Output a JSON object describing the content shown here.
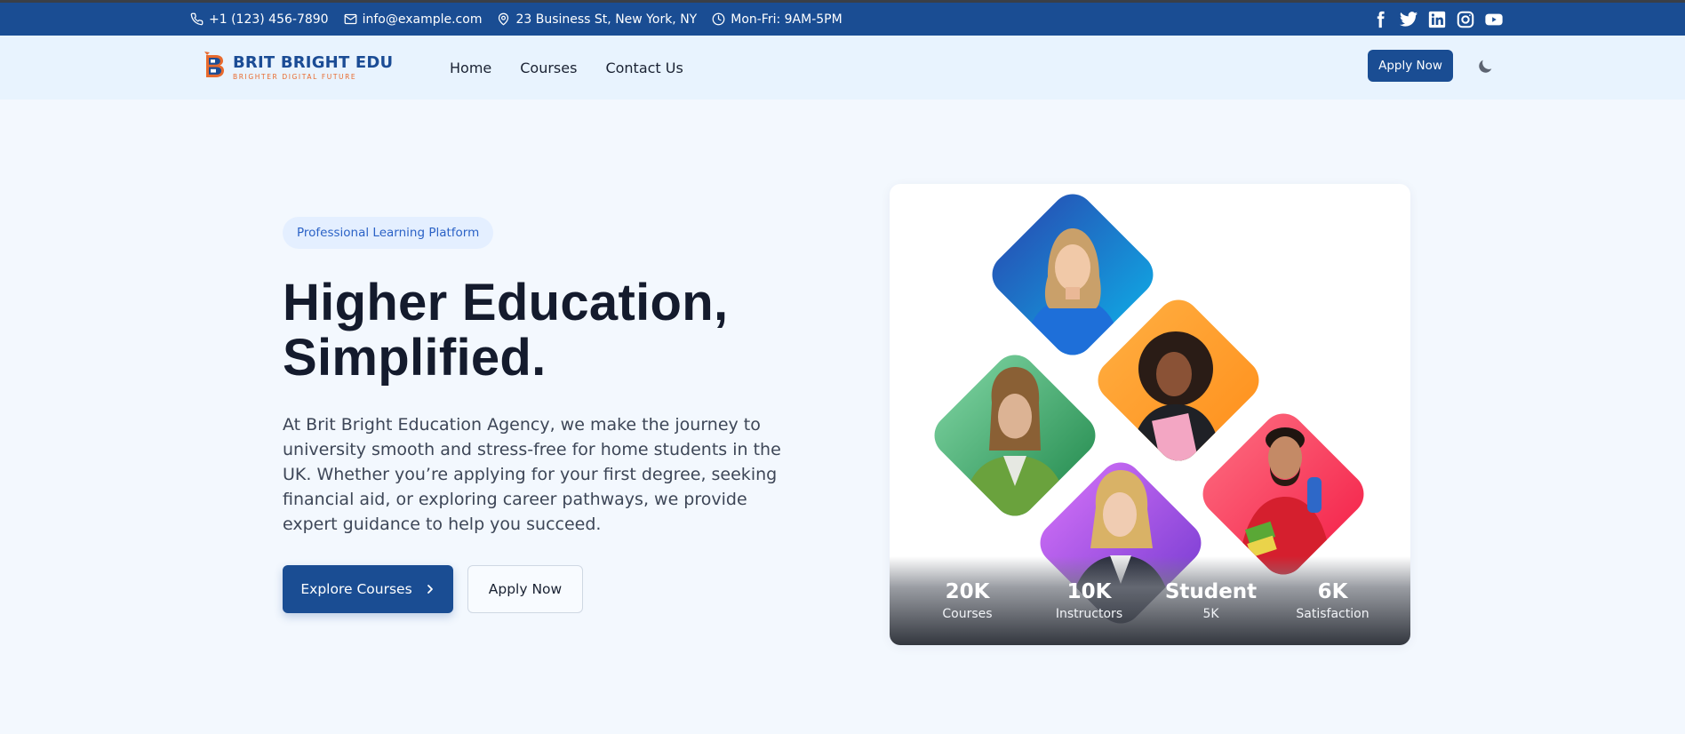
{
  "topbar": {
    "phone": "+1 (123) 456-7890",
    "email": "info@example.com",
    "address": "23 Business St, New York, NY",
    "hours": "Mon-Fri: 9AM-5PM",
    "social": [
      "facebook-icon",
      "twitter-icon",
      "linkedin-icon",
      "instagram-icon",
      "youtube-icon"
    ]
  },
  "nav": {
    "logo_name": "BRIT BRIGHT EDU",
    "logo_tagline": "BRIGHTER DIGITAL FUTURE",
    "items": [
      "Home",
      "Courses",
      "Contact Us"
    ],
    "apply_label": "Apply Now",
    "theme_toggle_icon": "moon-icon"
  },
  "hero": {
    "badge": "Professional Learning Platform",
    "title_line1": "Higher Education,",
    "title_line2": "Simplified.",
    "description": "At Brit Bright Education Agency, we make the journey to university smooth and stress-free for home students in the UK. Whether you’re applying for your first degree, seeking financial aid, or exploring career pathways, we provide expert guidance to help you succeed.",
    "primary_cta": "Explore Courses",
    "secondary_cta": "Apply Now"
  },
  "stats": [
    {
      "value": "20K",
      "label": "Courses"
    },
    {
      "value": "10K",
      "label": "Instructors"
    },
    {
      "value": "Student",
      "label": "5K"
    },
    {
      "value": "6K",
      "label": "Satisfaction"
    }
  ],
  "colors": {
    "brand": "#1a4d93",
    "accent": "#e86a2e",
    "background": "#f3f8fe"
  }
}
